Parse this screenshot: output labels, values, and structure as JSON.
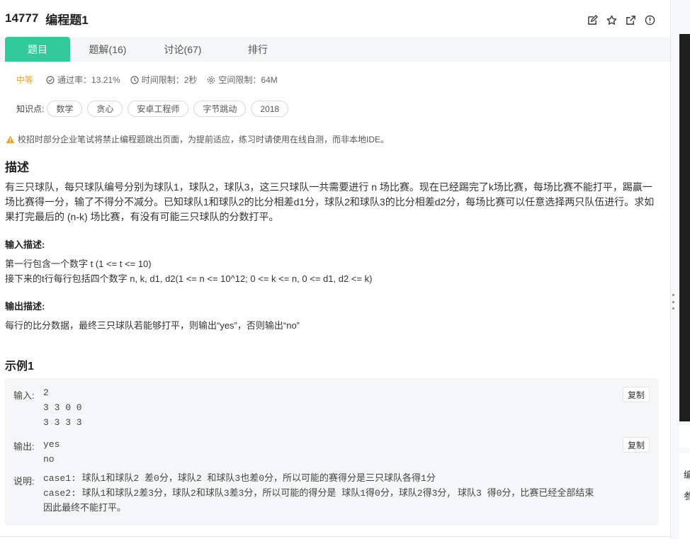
{
  "header": {
    "problem_id": "14777",
    "title": "编程题1"
  },
  "tabs": [
    {
      "label": "题目"
    },
    {
      "label": "题解(16)"
    },
    {
      "label": "讨论(67)"
    },
    {
      "label": "排行"
    }
  ],
  "meta": {
    "difficulty": "中等",
    "pass_rate": "通过率：13.21%",
    "time_limit": "时间限制：2秒",
    "space_limit": "空间限制：64M"
  },
  "tags": {
    "label": "知识点:",
    "items": [
      "数学",
      "贪心",
      "安卓工程师",
      "字节跳动",
      "2018"
    ]
  },
  "warning": "校招时部分企业笔试将禁止编程题跳出页面，为提前适应，练习时请使用在线自测，而非本地IDE。",
  "description": {
    "heading": "描述",
    "text": "有三只球队，每只球队编号分别为球队1，球队2，球队3，这三只球队一共需要进行 n 场比赛。现在已经踢完了k场比赛，每场比赛不能打平，踢赢一场比赛得一分，输了不得分不减分。已知球队1和球队2的比分相差d1分，球队2和球队3的比分相差d2分，每场比赛可以任意选择两只队伍进行。求如果打完最后的 (n-k) 场比赛，有没有可能三只球队的分数打平。"
  },
  "input_desc": {
    "heading": "输入描述:",
    "line1": "第一行包含一个数字 t (1 <= t <= 10)",
    "line2": "接下来的t行每行包括四个数字 n, k, d1, d2(1 <= n <= 10^12; 0 <= k <= n, 0 <= d1, d2 <= k)"
  },
  "output_desc": {
    "heading": "输出描述:",
    "line1": "每行的比分数据，最终三只球队若能够打平，则输出“yes”，否则输出“no”"
  },
  "example": {
    "heading": "示例1",
    "input_label": "输入:",
    "input_lines": [
      "2",
      "3 3 0 0",
      "3 3 3 3"
    ],
    "output_label": "输出:",
    "output_lines": [
      "yes",
      "no"
    ],
    "note_label": "说明:",
    "note_lines": [
      "case1: 球队1和球队2 差0分，球队2 和球队3也差0分，所以可能的赛得分是三只球队各得1分",
      "case2: 球队1和球队2差3分，球队2和球队3差3分，所以可能的得分是 球队1得0分，球队2得3分, 球队3 得0分，比赛已经全部结束",
      "因此最终不能打平。"
    ],
    "copy_label": "复制"
  },
  "right_strip": {
    "char1": "编",
    "char2": "参"
  },
  "colors": {
    "accent": "#32ca99",
    "difficulty": "#f0a11c",
    "warning": "#f0a11c"
  },
  "icons": [
    "edit-icon",
    "star-icon",
    "share-icon",
    "info-icon",
    "check-circle-icon",
    "clock-icon",
    "gear-icon",
    "warning-icon"
  ]
}
